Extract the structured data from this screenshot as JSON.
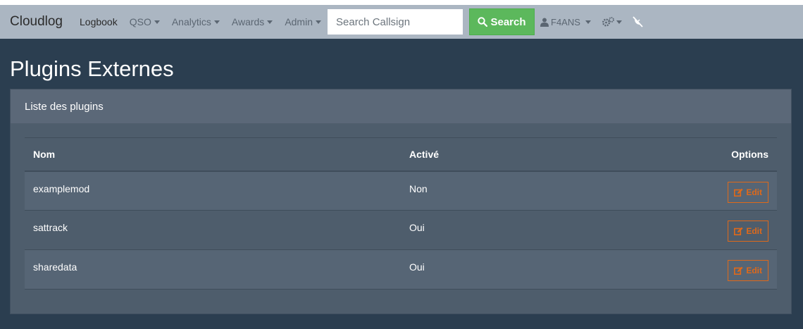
{
  "nav": {
    "brand": "Cloudlog",
    "items": [
      {
        "label": "Logbook",
        "caret": false
      },
      {
        "label": "QSO",
        "caret": true
      },
      {
        "label": "Analytics",
        "caret": true
      },
      {
        "label": "Awards",
        "caret": true
      },
      {
        "label": "Admin",
        "caret": true
      }
    ],
    "search_placeholder": "Search Callsign",
    "search_button": "Search",
    "user": "F4ANS"
  },
  "page": {
    "title": "Plugins Externes",
    "card_title": "Liste des plugins"
  },
  "table": {
    "headers": {
      "name": "Nom",
      "active": "Activé",
      "options": "Options"
    },
    "rows": [
      {
        "name": "examplemod",
        "active": "Non",
        "action": "Edit"
      },
      {
        "name": "sattrack",
        "active": "Oui",
        "action": "Edit"
      },
      {
        "name": "sharedata",
        "active": "Oui",
        "action": "Edit"
      }
    ]
  },
  "colors": {
    "background": "#2b3e50",
    "navbar": "#abb6c2",
    "success": "#5cb85c",
    "warning": "#df691a"
  }
}
